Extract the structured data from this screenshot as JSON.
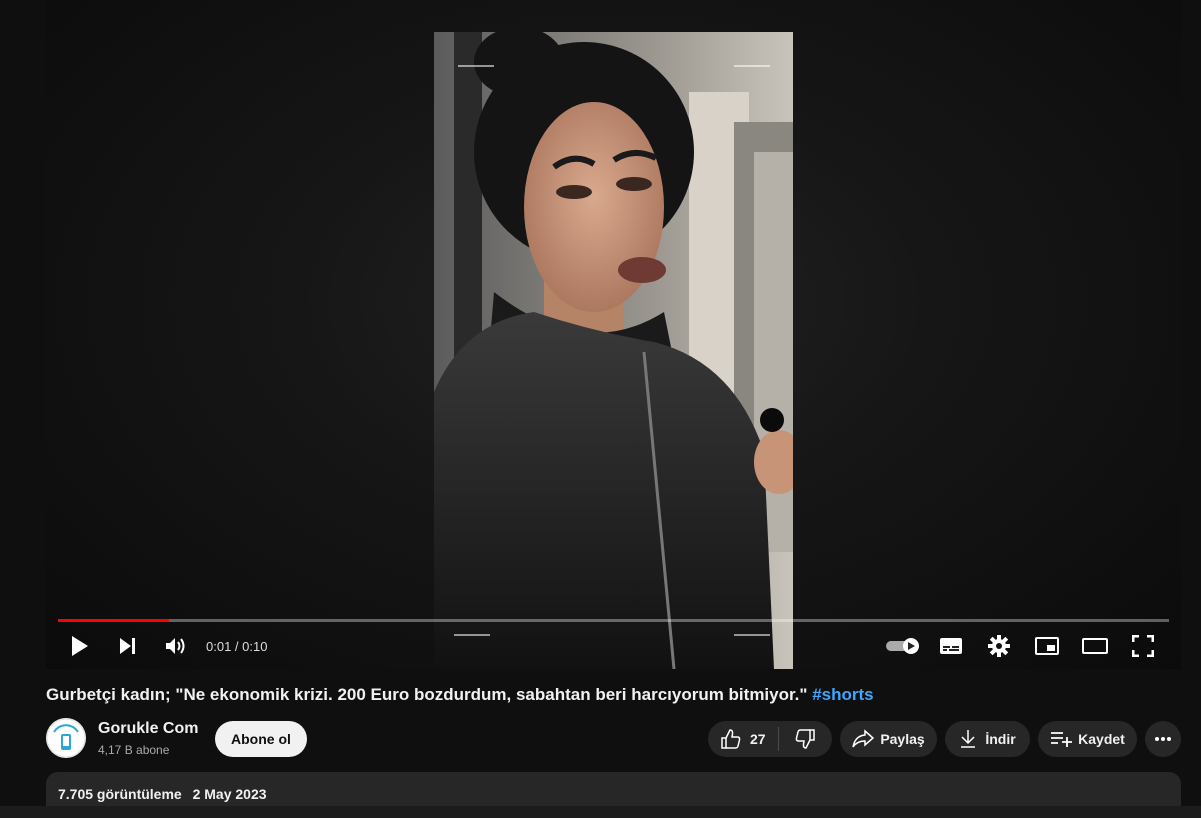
{
  "player": {
    "progress": 0.1,
    "current_time": "0:01",
    "duration": "0:10",
    "time_display": "0:01 / 0:10",
    "controls": {
      "play": "play-icon",
      "next": "next-icon",
      "volume": "volume-icon",
      "autoplay": "autoplay-toggle-icon",
      "subtitles": "subtitles-icon",
      "settings": "gear-icon",
      "miniplayer": "miniplayer-icon",
      "theater": "theater-icon",
      "fullscreen": "fullscreen-icon"
    }
  },
  "video": {
    "title": "Gurbetçi kadın; \"Ne ekonomik krizi. 200 Euro bozdurdum, sabahtan beri harcıyorum bitmiyor.\"",
    "hashtag": "#shorts"
  },
  "channel": {
    "name": "Gorukle Com",
    "subscribers": "4,17 B abone",
    "subscribe_label": "Abone ol"
  },
  "actions": {
    "like_count": "27",
    "share_label": "Paylaş",
    "download_label": "İndir",
    "save_label": "Kaydet"
  },
  "description": {
    "views": "7.705 görüntüleme",
    "date": "2 May 2023"
  },
  "colors": {
    "background": "#0f0f0f",
    "progress": "#ff0000",
    "hashtag": "#3ea6ff",
    "pill": "#272727"
  }
}
